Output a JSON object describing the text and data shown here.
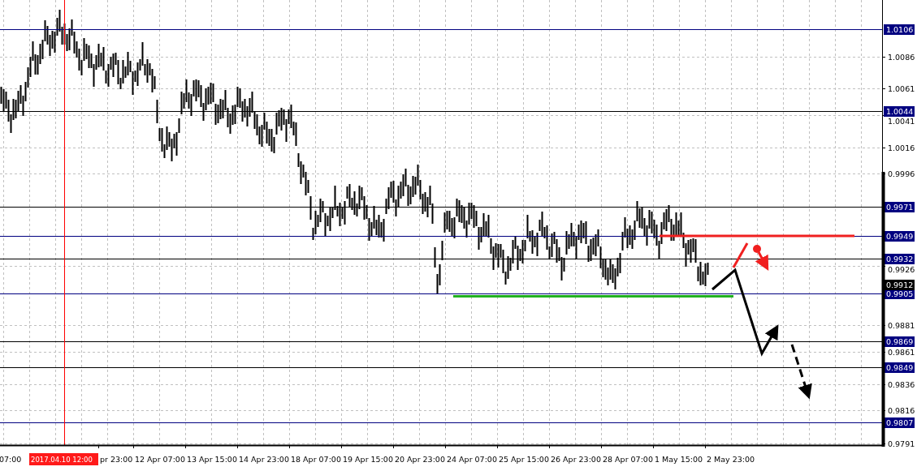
{
  "price_axis": {
    "ticks": [
      "1.0086",
      "1.0061",
      "1.0041",
      "1.0016",
      "0.9996",
      "0.9926",
      "0.9881",
      "0.9861",
      "0.9836",
      "0.9816",
      "0.9791"
    ]
  },
  "levels": [
    {
      "label": "1.0106",
      "color": "#000080"
    },
    {
      "label": "1.0044",
      "color": "#000000"
    },
    {
      "label": "0.9971",
      "color": "#000000"
    },
    {
      "label": "0.9949",
      "color": "#000080"
    },
    {
      "label": "0.9932",
      "color": "#000000"
    },
    {
      "label": "0.9905",
      "color": "#000080"
    },
    {
      "label": "0.9869",
      "color": "#000000"
    },
    {
      "label": "0.9849",
      "color": "#000000"
    },
    {
      "label": "0.9807",
      "color": "#000080"
    }
  ],
  "current_price": {
    "label": "0.9912"
  },
  "crosshair": {
    "label": "2017.04.10 12:00"
  },
  "time_axis": {
    "labels": [
      "07:00",
      "pr 23:00",
      "12 Apr 07:00",
      "13 Apr 15:00",
      "14 Apr 23:00",
      "18 Apr 07:00",
      "19 Apr 15:00",
      "20 Apr 23:00",
      "24 Apr 07:00",
      "25 Apr 15:00",
      "26 Apr 23:00",
      "28 Apr 07:00",
      "1 May 15:00",
      "2 May 23:00"
    ]
  }
}
